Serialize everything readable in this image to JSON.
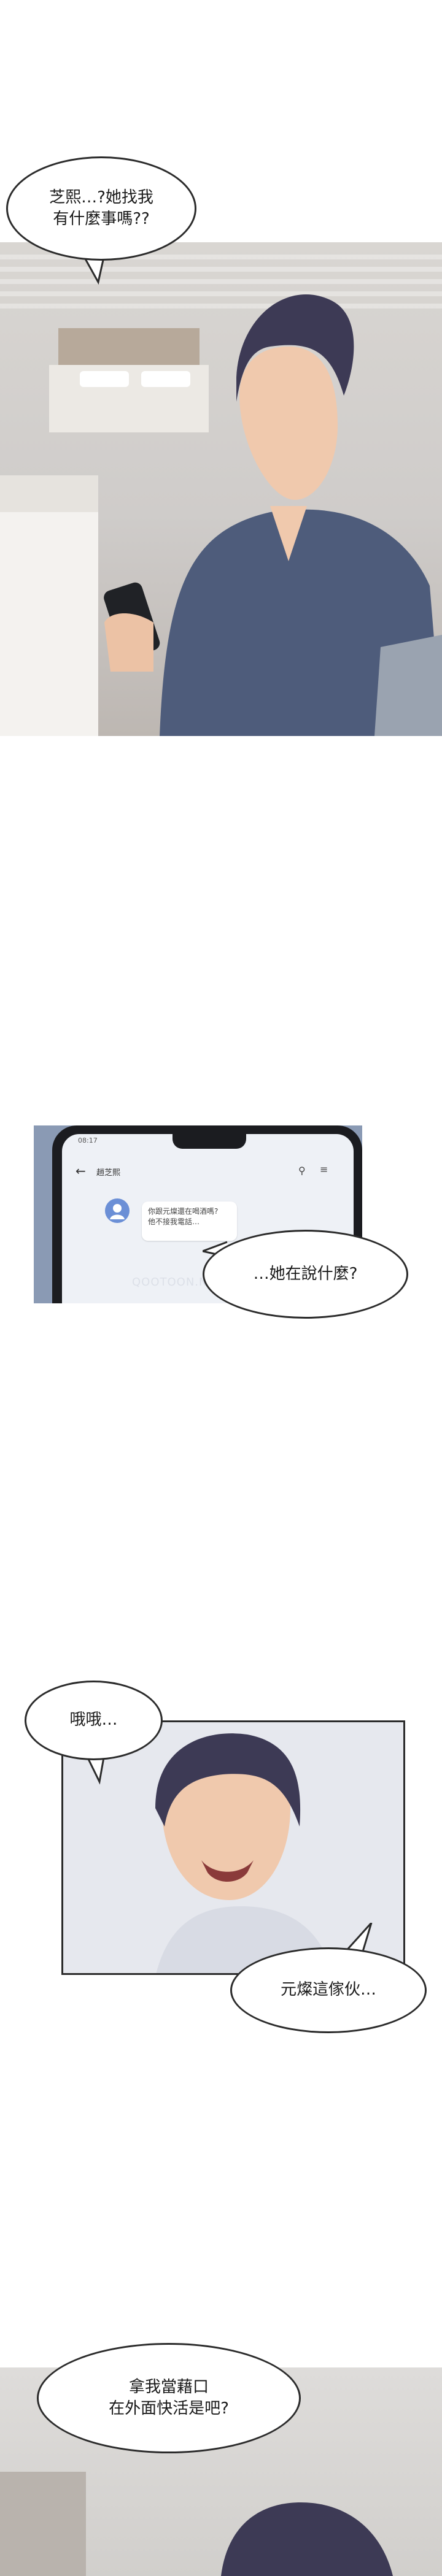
{
  "bubbles": {
    "b1": "芝熙…?她找我\n有什麼事嗎??",
    "b2": "…她在說什麼?",
    "b3": "哦哦…",
    "b4": "元燦這傢伙…",
    "b5": "拿我當藉口\n在外面快活是吧?"
  },
  "phone": {
    "status_time": "08:17",
    "contact_name": "趙芝熙",
    "message": "你跟元燦還在喝酒嗎?\n他不接我電話…"
  },
  "watermark": "QOOTOON.NET",
  "colors": {
    "accent": "#7e8fae",
    "outline": "#2b2b2b"
  }
}
